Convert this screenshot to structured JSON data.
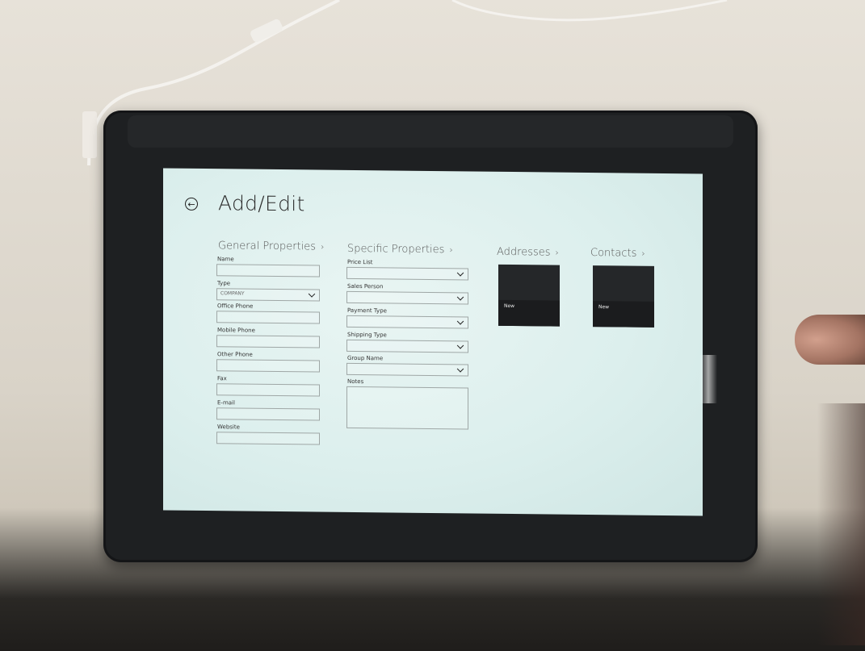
{
  "app": {
    "title": "Add/Edit"
  },
  "general": {
    "header": "General Properties",
    "fields": [
      {
        "label": "Name",
        "value": ""
      },
      {
        "label": "Type",
        "value": "COMPANY"
      },
      {
        "label": "Office Phone",
        "value": ""
      },
      {
        "label": "Mobile Phone",
        "value": ""
      },
      {
        "label": "Other Phone",
        "value": ""
      },
      {
        "label": "Fax",
        "value": ""
      },
      {
        "label": "E-mail",
        "value": ""
      },
      {
        "label": "Website",
        "value": ""
      }
    ]
  },
  "specific": {
    "header": "Specific Properties",
    "fields": [
      {
        "label": "Price List",
        "value": ""
      },
      {
        "label": "Sales Person",
        "value": ""
      },
      {
        "label": "Payment Type",
        "value": ""
      },
      {
        "label": "Shipping Type",
        "value": ""
      },
      {
        "label": "Group Name",
        "value": ""
      },
      {
        "label": "Notes",
        "value": ""
      }
    ]
  },
  "addresses": {
    "header": "Addresses",
    "tile_label": "New"
  },
  "contacts": {
    "header": "Contacts",
    "tile_label": "New"
  },
  "icons": {
    "back": "back-arrow-icon",
    "chevron": "chevron-right-icon",
    "dropdown": "chevron-down-icon"
  }
}
